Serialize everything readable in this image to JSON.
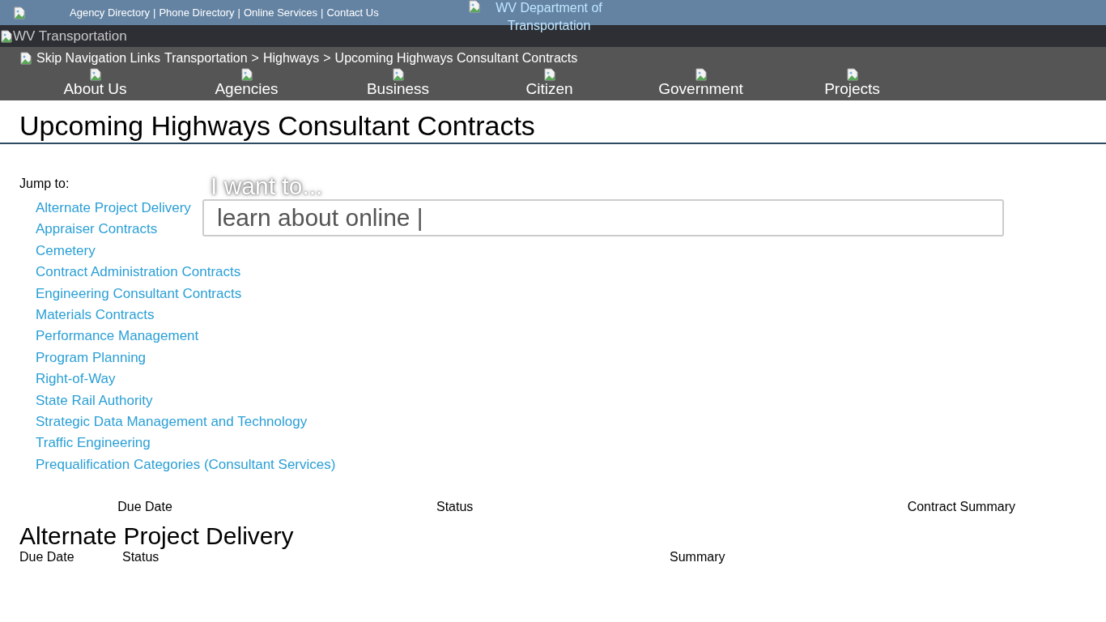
{
  "top_bar": {
    "links": [
      "Agency Directory",
      "Phone Directory",
      "Online Services",
      "Contact Us"
    ],
    "separator": "|",
    "logo_alt": "WV Department of Transportation"
  },
  "brand_bar": {
    "logo_alt": "WV Transportation"
  },
  "nav_bar": {
    "breadcrumb": {
      "skip": "Skip Navigation Links",
      "items": [
        "Transportation",
        "Highways",
        "Upcoming Highways Consultant Contracts"
      ],
      "separator": ">"
    },
    "items": [
      {
        "label": "About Us"
      },
      {
        "label": "Agencies"
      },
      {
        "label": "Business"
      },
      {
        "label": "Citizen"
      },
      {
        "label": "Government"
      },
      {
        "label": "Projects"
      }
    ]
  },
  "page_title": "Upcoming Highways Consultant Contracts",
  "jump_to": {
    "label": "Jump to:",
    "links": [
      "Alternate Project Delivery",
      "Appraiser Contracts",
      "Cemetery",
      "Contract Administration Contracts",
      "Engineering Consultant Contracts",
      "Materials Contracts",
      "Performance Management",
      "Program Planning",
      "Right-of-Way",
      "State Rail Authority",
      "Strategic Data Management and Technology",
      "Traffic Engineering",
      "Prequalification Categories (Consultant Services)"
    ]
  },
  "search_widget": {
    "heading": "I want to...",
    "value": "learn about online |"
  },
  "table": {
    "columns": [
      "Due Date",
      "Status",
      "Contract Summary"
    ]
  },
  "sections": [
    {
      "title": "Alternate Project Delivery",
      "columns": [
        "Due Date",
        "Status",
        "Summary"
      ]
    }
  ]
}
